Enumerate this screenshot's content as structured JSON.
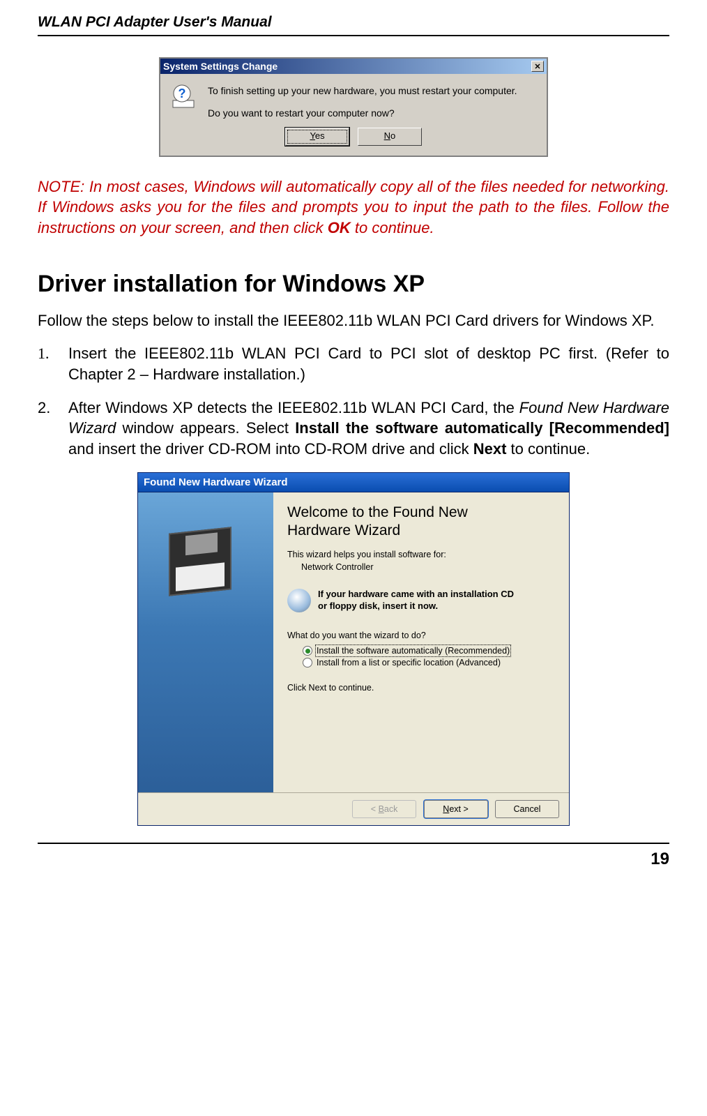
{
  "header": {
    "title": "WLAN PCI Adapter User's Manual"
  },
  "page_number": "19",
  "dlg1": {
    "title": "System Settings Change",
    "line1": "To finish setting up your new hardware, you must restart your computer.",
    "line2": "Do you want to restart your computer now?",
    "yes_u": "Y",
    "yes_rest": "es",
    "no_u": "N",
    "no_rest": "o"
  },
  "note": {
    "pre": "NOTE: In most cases, Windows will automatically copy all of the files needed for networking. If Windows asks you for the files and prompts you to input the path to the files. Follow the instructions on your screen, and then click ",
    "bold": "OK",
    "post": " to continue."
  },
  "section_title": "Driver installation for Windows XP",
  "intro": "Follow the steps below to install the IEEE802.11b WLAN PCI Card drivers for Windows XP.",
  "steps": [
    {
      "num": "1.",
      "font": "serif",
      "segments": [
        {
          "t": "Insert the IEEE802.11b WLAN PCI Card to PCI slot of desktop PC first. (Refer to Chapter 2 – Hardware installation.)"
        }
      ]
    },
    {
      "num": "2.",
      "font": "sans",
      "segments": [
        {
          "t": "After Windows XP detects the IEEE802.11b WLAN PCI Card, the "
        },
        {
          "t": "Found New Hardware Wizard",
          "i": true
        },
        {
          "t": " window appears. Select "
        },
        {
          "t": "Install the software automatically [Recommended]",
          "b": true
        },
        {
          "t": " and insert the driver CD-ROM into CD-ROM drive and click "
        },
        {
          "t": "Next",
          "b": true
        },
        {
          "t": " to continue."
        }
      ]
    }
  ],
  "dlg2": {
    "title": "Found New Hardware Wizard",
    "welcome1": "Welcome to the Found New",
    "welcome2": "Hardware Wizard",
    "helps": "This wizard helps you install software for:",
    "device": "Network Controller",
    "cd1": "If your hardware came with an installation CD",
    "cd2": "or floppy disk, insert it now.",
    "question": "What do you want the wizard to do?",
    "opt1": "Install the software automatically (Recommended)",
    "opt2": "Install from a list or specific location (Advanced)",
    "cont": "Click Next to continue.",
    "back_lt": "< ",
    "back_u": "B",
    "back_rest": "ack",
    "next_u": "N",
    "next_rest": "ext >",
    "cancel": "Cancel"
  }
}
